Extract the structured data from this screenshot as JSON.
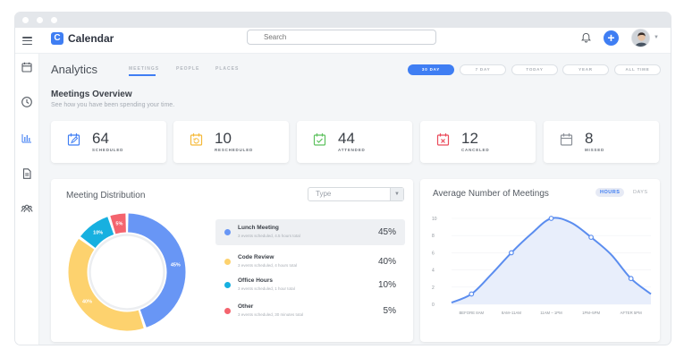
{
  "app": {
    "logo_letter": "C",
    "name": "Calendar"
  },
  "search": {
    "placeholder": "Search"
  },
  "page": {
    "title": "Analytics",
    "tabs": [
      {
        "label": "MEETINGS",
        "active": true
      },
      {
        "label": "PEOPLE",
        "active": false
      },
      {
        "label": "PLACES",
        "active": false
      }
    ],
    "ranges": [
      {
        "label": "30 DAY",
        "active": true
      },
      {
        "label": "7 DAY",
        "active": false
      },
      {
        "label": "TODAY",
        "active": false
      },
      {
        "label": "YEAR",
        "active": false
      },
      {
        "label": "ALL TIME",
        "active": false
      }
    ]
  },
  "overview": {
    "title": "Meetings Overview",
    "subtitle": "See how you have been spending your time.",
    "stats": [
      {
        "value": "64",
        "label": "SCHEDULED",
        "icon": "calendar-edit-icon",
        "color": "#3f7ef3"
      },
      {
        "value": "10",
        "label": "RESCHEDULED",
        "icon": "calendar-reschedule-icon",
        "color": "#f5b938"
      },
      {
        "value": "44",
        "label": "ATTENDED",
        "icon": "calendar-check-icon",
        "color": "#5cc15d"
      },
      {
        "value": "12",
        "label": "CANCELED",
        "icon": "calendar-cancel-icon",
        "color": "#ea4a5a"
      },
      {
        "value": "8",
        "label": "MISSED",
        "icon": "calendar-missed-icon",
        "color": "#8b9098"
      }
    ]
  },
  "distribution": {
    "title": "Meeting Distribution",
    "type_placeholder": "Type",
    "items": [
      {
        "name": "Lunch Meeting",
        "desc": "3 events scheduled, 4.5 hours total",
        "pct": "45%",
        "value": 45,
        "color": "#6896f5"
      },
      {
        "name": "Code Review",
        "desc": "3 events scheduled, 4 hours total",
        "pct": "40%",
        "value": 40,
        "color": "#fdd26e"
      },
      {
        "name": "Office Hours",
        "desc": "3 events scheduled, 1 hour total",
        "pct": "10%",
        "value": 10,
        "color": "#17b0e0"
      },
      {
        "name": "Other",
        "desc": "3 events scheduled, 30 minutes total",
        "pct": "5%",
        "value": 5,
        "color": "#f4646e"
      }
    ]
  },
  "average": {
    "title": "Average Number of Meetings",
    "toggle": [
      {
        "label": "HOURS",
        "active": true
      },
      {
        "label": "DAYS",
        "active": false
      }
    ]
  },
  "chart_data": [
    {
      "type": "pie",
      "title": "Meeting Distribution",
      "categories": [
        "Lunch Meeting",
        "Code Review",
        "Office Hours",
        "Other"
      ],
      "values": [
        45,
        40,
        10,
        5
      ],
      "data_labels": [
        "45%",
        "40%",
        "10%",
        "5%"
      ],
      "colors": [
        "#6896f5",
        "#fdd26e",
        "#17b0e0",
        "#f4646e"
      ]
    },
    {
      "type": "area",
      "title": "Average Number of Meetings",
      "categories": [
        "BEFORE 8AM",
        "8AM–11AM",
        "11AM – 1PM",
        "1PM–5PM",
        "AFTER 5PM"
      ],
      "x": [
        0,
        0.5,
        1,
        1.5,
        2,
        2.5,
        3,
        3.5,
        4,
        4.5,
        5
      ],
      "y": [
        0.2,
        1.2,
        3.5,
        6.0,
        8.2,
        10.0,
        9.5,
        7.8,
        5.8,
        3.0,
        1.2
      ],
      "marker_indices": [
        1,
        3,
        5,
        7,
        9
      ],
      "yticks": [
        0,
        2,
        4,
        6,
        8,
        10
      ],
      "ylim": [
        0,
        10
      ],
      "color": "#5b8def"
    }
  ]
}
